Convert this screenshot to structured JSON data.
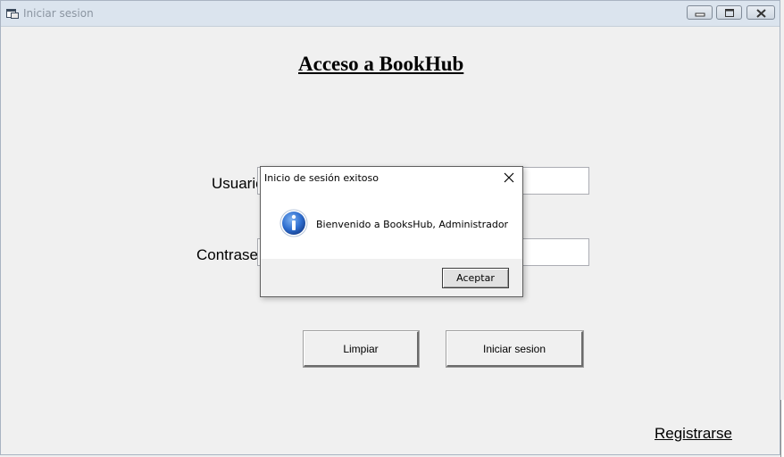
{
  "window": {
    "title": "Iniciar sesion",
    "icon": "window-app-icon",
    "controls": [
      "minimize-icon",
      "maximize-icon",
      "close-icon"
    ]
  },
  "form": {
    "heading": "Acceso a BookHub",
    "user_label": "Usuario",
    "password_label": "Contraseña",
    "user_value": "",
    "password_value": "",
    "clear_button": "Limpiar",
    "login_button": "Iniciar sesion",
    "register_link": "Registrarse"
  },
  "dialog": {
    "title": "Inicio de sesión exitoso",
    "message": "Bienvenido a BooksHub, Administrador",
    "ok_button": "Aceptar",
    "icon": "info-icon"
  },
  "colors": {
    "titlebar": "#dbe4ee",
    "window_bg": "#f0f0f0",
    "info_blue": "#1f5fbf"
  }
}
